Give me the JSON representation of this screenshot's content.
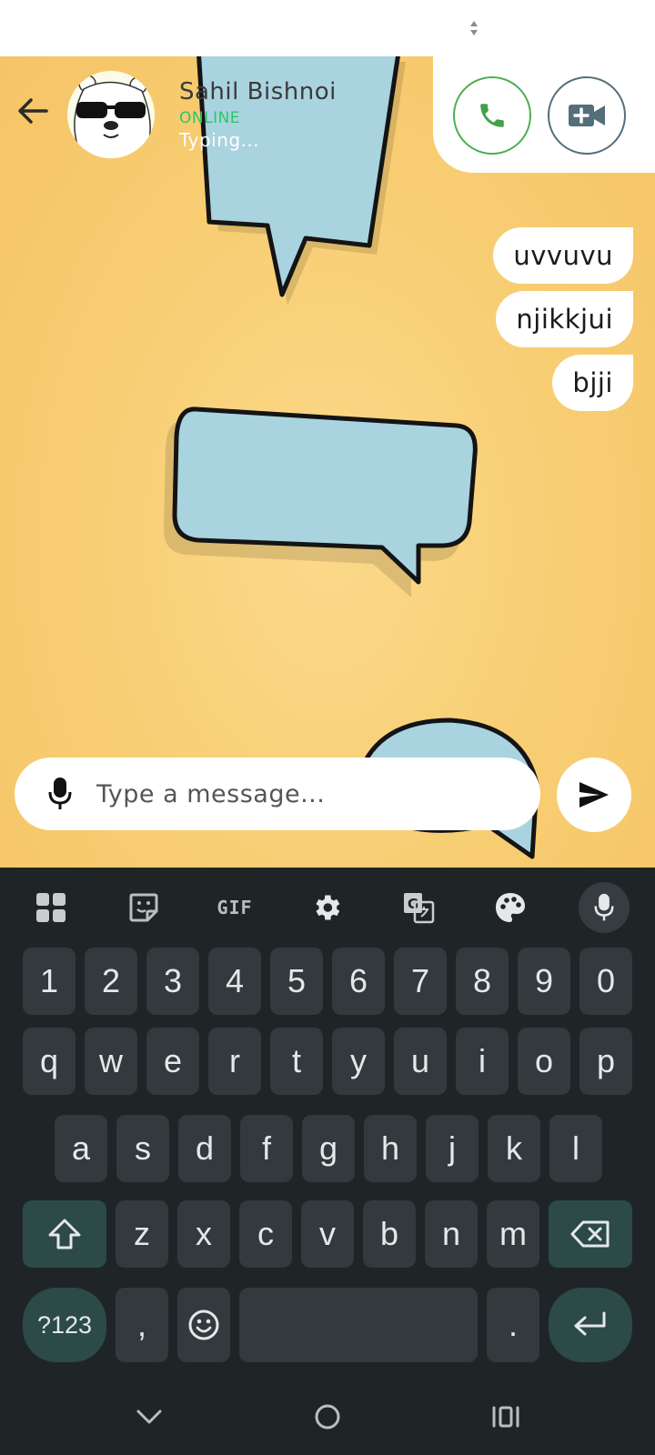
{
  "contact": {
    "name": "Sahil Bishnoi",
    "status": "ONLINE",
    "typing": "Typing..."
  },
  "messages": [
    {
      "text": "uvvuvu"
    },
    {
      "text": "njikkjui"
    },
    {
      "text": "bjji"
    }
  ],
  "input": {
    "placeholder": "Type a message..."
  },
  "keyboard": {
    "toolbar": {
      "gif_label": "GIF"
    },
    "rows": {
      "numbers": [
        "1",
        "2",
        "3",
        "4",
        "5",
        "6",
        "7",
        "8",
        "9",
        "0"
      ],
      "row1": [
        "q",
        "w",
        "e",
        "r",
        "t",
        "y",
        "u",
        "i",
        "o",
        "p"
      ],
      "row2": [
        "a",
        "s",
        "d",
        "f",
        "g",
        "h",
        "j",
        "k",
        "l"
      ],
      "row3": [
        "z",
        "x",
        "c",
        "v",
        "b",
        "n",
        "m"
      ]
    },
    "symbols_label": "?123",
    "comma_label": ",",
    "period_label": "."
  },
  "colors": {
    "online": "#2ec46a",
    "call_green": "#4caf50",
    "video_gray": "#546e7a",
    "keyboard_bg": "#1f2527",
    "key_bg": "#33393c",
    "fn_key_bg": "#2c4a47",
    "chat_bg": "#f8cd72"
  },
  "icons": {
    "back": "arrow-left-icon",
    "voice_call": "phone-icon",
    "video_call": "video-plus-icon",
    "mic": "microphone-icon",
    "send": "send-icon",
    "apps": "grid-icon",
    "sticker": "sticker-icon",
    "settings": "gear-icon",
    "translate": "translate-icon",
    "theme": "palette-icon",
    "shift": "shift-icon",
    "backspace": "backspace-icon",
    "emoji": "emoji-icon",
    "enter": "enter-icon"
  }
}
